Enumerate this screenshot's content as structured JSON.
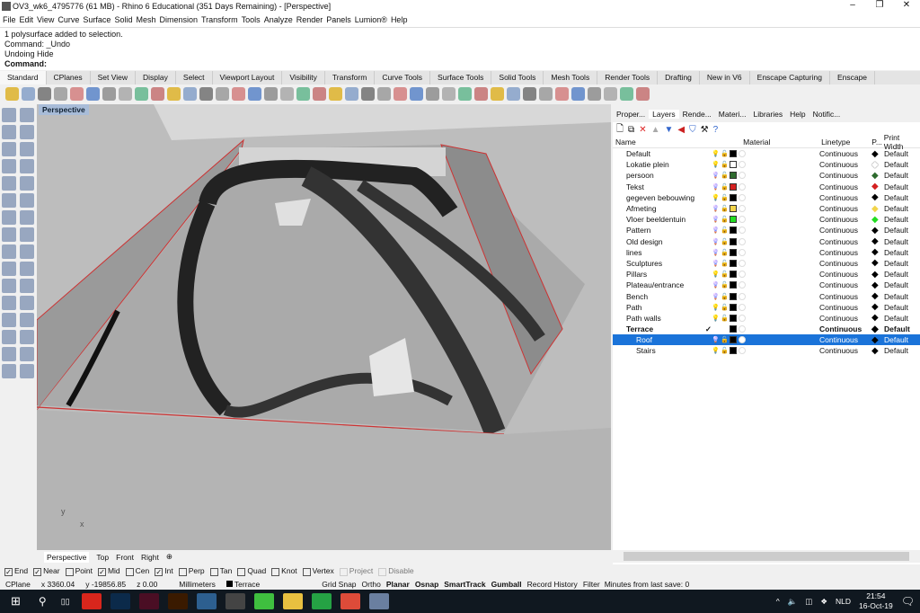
{
  "window": {
    "title": "OV3_wk6_4795776 (61 MB) - Rhino 6 Educational (351 Days Remaining) - [Perspective]",
    "controls": [
      "–",
      "❐",
      "✕"
    ]
  },
  "menu": [
    "File",
    "Edit",
    "View",
    "Curve",
    "Surface",
    "Solid",
    "Mesh",
    "Dimension",
    "Transform",
    "Tools",
    "Analyze",
    "Render",
    "Panels",
    "Lumion®",
    "Help"
  ],
  "command_history": [
    "1 polysurface added to selection.",
    "Command: _Undo",
    "Undoing Hide"
  ],
  "command_prompt": "Command:",
  "toolbar_tabs": [
    "Standard",
    "CPlanes",
    "Set View",
    "Display",
    "Select",
    "Viewport Layout",
    "Visibility",
    "Transform",
    "Curve Tools",
    "Surface Tools",
    "Solid Tools",
    "Mesh Tools",
    "Render Tools",
    "Drafting",
    "New in V6",
    "Enscape Capturing",
    "Enscape"
  ],
  "active_toolbar_tab": "Standard",
  "viewport": {
    "label": "Perspective",
    "axis_y": "y",
    "axis_x": "x"
  },
  "viewport_tabs": [
    "Perspective",
    "Top",
    "Front",
    "Right"
  ],
  "panel_tabs": [
    "Proper...",
    "Layers",
    "Rende...",
    "Materi...",
    "Libraries",
    "Help",
    "Notific..."
  ],
  "active_panel_tab": "Layers",
  "layer_columns": {
    "name": "Name",
    "material": "Material",
    "linetype": "Linetype",
    "print_color": "P...",
    "print_width": "Print Width"
  },
  "layers": [
    {
      "name": "Default",
      "on": true,
      "color": "#000000",
      "linetype": "Continuous",
      "print_width": "Default"
    },
    {
      "name": "Lokatie plein",
      "on": true,
      "color": "#ffffff",
      "linetype": "Continuous",
      "print_width": "Default"
    },
    {
      "name": "persoon",
      "on": false,
      "color": "#2e6b2e",
      "linetype": "Continuous",
      "print_width": "Default"
    },
    {
      "name": "Tekst",
      "on": false,
      "color": "#d42020",
      "linetype": "Continuous",
      "print_width": "Default",
      "expandable": true
    },
    {
      "name": "gegeven bebouwing",
      "on": true,
      "color": "#000000",
      "linetype": "Continuous",
      "print_width": "Default",
      "expandable": true
    },
    {
      "name": "Afmeting",
      "on": false,
      "color": "#f2d44a",
      "linetype": "Continuous",
      "print_width": "Default"
    },
    {
      "name": "Vloer beeldentuin",
      "on": false,
      "color": "#22dd22",
      "linetype": "Continuous",
      "print_width": "Default"
    },
    {
      "name": "Pattern",
      "on": false,
      "color": "#000000",
      "linetype": "Continuous",
      "print_width": "Default"
    },
    {
      "name": "Old design",
      "on": false,
      "color": "#000000",
      "linetype": "Continuous",
      "print_width": "Default"
    },
    {
      "name": "lines",
      "on": false,
      "color": "#000000",
      "linetype": "Continuous",
      "print_width": "Default"
    },
    {
      "name": "Sculptures",
      "on": false,
      "color": "#000000",
      "linetype": "Continuous",
      "print_width": "Default"
    },
    {
      "name": "Pillars",
      "on": true,
      "color": "#000000",
      "linetype": "Continuous",
      "print_width": "Default"
    },
    {
      "name": "Plateau/entrance",
      "on": false,
      "color": "#000000",
      "linetype": "Continuous",
      "print_width": "Default"
    },
    {
      "name": "Bench",
      "on": false,
      "color": "#000000",
      "linetype": "Continuous",
      "print_width": "Default"
    },
    {
      "name": "Path",
      "on": true,
      "color": "#000000",
      "linetype": "Continuous",
      "print_width": "Default"
    },
    {
      "name": "Path walls",
      "on": true,
      "color": "#000000",
      "linetype": "Continuous",
      "print_width": "Default"
    },
    {
      "name": "Terrace",
      "current": true,
      "expanded": true,
      "color": "#000000",
      "linetype": "Continuous",
      "print_width": "Default"
    },
    {
      "name": "Roof",
      "on": false,
      "selected": true,
      "child": true,
      "color": "#000000",
      "linetype": "Continuous",
      "print_width": "Default"
    },
    {
      "name": "Stairs",
      "on": true,
      "child": true,
      "color": "#000000",
      "linetype": "Continuous",
      "print_width": "Default"
    }
  ],
  "osnap": [
    {
      "label": "End",
      "checked": true
    },
    {
      "label": "Near",
      "checked": true
    },
    {
      "label": "Point",
      "checked": false
    },
    {
      "label": "Mid",
      "checked": true
    },
    {
      "label": "Cen",
      "checked": false
    },
    {
      "label": "Int",
      "checked": true
    },
    {
      "label": "Perp",
      "checked": false
    },
    {
      "label": "Tan",
      "checked": false
    },
    {
      "label": "Quad",
      "checked": false
    },
    {
      "label": "Knot",
      "checked": false
    },
    {
      "label": "Vertex",
      "checked": false
    },
    {
      "label": "Project",
      "checked": false,
      "disabled": true
    },
    {
      "label": "Disable",
      "checked": false,
      "disabled": true
    }
  ],
  "status": {
    "cplane": "CPlane",
    "x": "x 3360.04",
    "y": "y -19856.85",
    "z": "z 0.00",
    "units": "Millimeters",
    "layer": "Terrace",
    "toggles": [
      {
        "label": "Grid Snap",
        "bold": false
      },
      {
        "label": "Ortho",
        "bold": false
      },
      {
        "label": "Planar",
        "bold": true
      },
      {
        "label": "Osnap",
        "bold": true
      },
      {
        "label": "SmartTrack",
        "bold": true
      },
      {
        "label": "Gumball",
        "bold": true
      },
      {
        "label": "Record History",
        "bold": false
      },
      {
        "label": "Filter",
        "bold": false
      }
    ],
    "save_info": "Minutes from last save: 0"
  },
  "taskbar": {
    "apps": [
      {
        "name": "creative-cloud",
        "color": "#d9261c"
      },
      {
        "name": "photoshop",
        "color": "#0b2a4a"
      },
      {
        "name": "indesign",
        "color": "#4a0e24"
      },
      {
        "name": "illustrator",
        "color": "#3a1a00"
      },
      {
        "name": "app-blue",
        "color": "#2d5f8f"
      },
      {
        "name": "rhino",
        "color": "#444444"
      },
      {
        "name": "lumion",
        "color": "#3fbf3f"
      },
      {
        "name": "file-explorer",
        "color": "#e8c040"
      },
      {
        "name": "whatsapp",
        "color": "#25a244"
      },
      {
        "name": "chrome",
        "color": "#dd4b39"
      },
      {
        "name": "app-paint",
        "color": "#6a7fa0"
      }
    ],
    "language": "NLD",
    "time": "21:54",
    "date": "16-Oct-19"
  }
}
